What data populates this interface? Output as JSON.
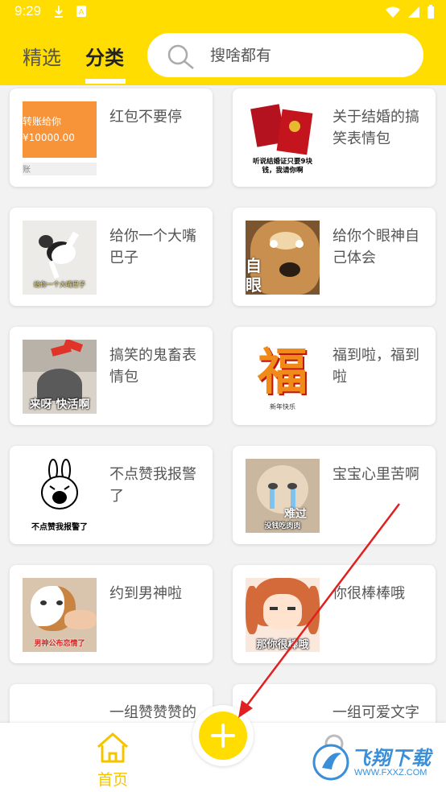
{
  "status_bar": {
    "time": "9:29"
  },
  "header": {
    "tabs": [
      {
        "label": "精选"
      },
      {
        "label": "分类"
      }
    ],
    "active_tab": 1,
    "search": {
      "placeholder": "搜啥都有"
    },
    "accent": "#ffdd00"
  },
  "cards": [
    {
      "title": "红包不要停",
      "thumb_icon": "red-envelope-transfer-icon",
      "thumb_text": [
        "转账给你",
        "¥10000.00",
        "账"
      ]
    },
    {
      "title": "关于结婚的搞笑表情包",
      "thumb_icon": "marriage-certificate-icon",
      "thumb_text": [
        "听说结婚证只要9块",
        "钱，我请你啊"
      ]
    },
    {
      "title": "给你一个大嘴巴子",
      "thumb_icon": "cat-slap-icon",
      "thumb_text": [
        "给你一个大嘴巴子"
      ]
    },
    {
      "title": "给你个眼神自己体会",
      "thumb_icon": "dog-side-eye-icon",
      "thumb_text": [
        "自",
        "眼"
      ]
    },
    {
      "title": "搞笑的鬼畜表情包",
      "thumb_icon": "cat-kitchen-icon",
      "thumb_text": [
        "来呀 快活啊"
      ]
    },
    {
      "title": "福到啦，福到啦",
      "thumb_icon": "fu-character-icon",
      "thumb_text": [
        "福",
        "新年快乐"
      ]
    },
    {
      "title": "不点赞我报警了",
      "thumb_icon": "rabbit-shout-icon",
      "thumb_text": [
        "不点赞我报警了"
      ]
    },
    {
      "title": "宝宝心里苦啊",
      "thumb_icon": "crying-kitten-icon",
      "thumb_text": [
        "难过",
        "没钱吃肉肉"
      ]
    },
    {
      "title": "约到男神啦",
      "thumb_icon": "cat-pet-icon",
      "thumb_text": [
        "男神公布恋情了"
      ]
    },
    {
      "title": "你很棒棒哦",
      "thumb_icon": "anime-girl-icon",
      "thumb_text": [
        "那你很棒哦"
      ]
    },
    {
      "title": "一组赞赞赞的",
      "thumb_icon": "blank-thumb-icon",
      "thumb_text": []
    },
    {
      "title": "一组可爱文字",
      "thumb_icon": "blank-thumb-icon",
      "thumb_text": []
    }
  ],
  "bottom_nav": {
    "home_label": "首页",
    "fab_icon": "plus-icon",
    "profile_icon": "user-icon"
  },
  "watermark": {
    "text": "飞翔下载",
    "url": "WWW.FXXZ.COM"
  },
  "annotation": {
    "color": "#e02020",
    "icon": "red-arrow-icon"
  }
}
